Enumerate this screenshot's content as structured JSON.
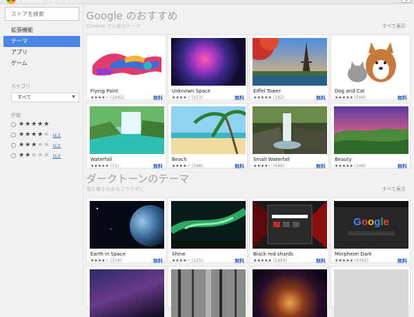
{
  "window": {
    "title": "Chrome ウェブストア",
    "corner_label": "×"
  },
  "search": {
    "placeholder": "ストアを検索"
  },
  "nav": [
    {
      "label": "拡張機能",
      "active": false
    },
    {
      "label": "テーマ",
      "active": true
    },
    {
      "label": "アプリ",
      "active": false
    },
    {
      "label": "ゲーム",
      "active": false
    }
  ],
  "filters": {
    "category_label": "カテゴリ",
    "category_value": "すべて",
    "rating_label": "評価",
    "rating_rows": [
      {
        "stars": 5,
        "suffix": ""
      },
      {
        "stars": 4,
        "suffix": "以上"
      },
      {
        "stars": 3,
        "suffix": "以上"
      },
      {
        "stars": 2,
        "suffix": "以上"
      }
    ]
  },
  "sections": [
    {
      "title": "Google のおすすめ",
      "subtitle": "Chrome で人気のテーマ",
      "view_all": "すべて表示"
    },
    {
      "title": "ダークトーンのテーマ",
      "subtitle": "落ち着きのあるブラウザに",
      "view_all": "すべて表示"
    }
  ],
  "cards": [
    {
      "name": "Flying Paint",
      "rating": 4,
      "count": "(1642)",
      "price": "無料",
      "thumb": "flying-paint"
    },
    {
      "name": "Unknown Space",
      "rating": 4,
      "count": "(523)",
      "price": "無料",
      "thumb": "unknown-space"
    },
    {
      "name": "Eiffel Tower",
      "rating": 4.5,
      "count": "(192)",
      "price": "無料",
      "thumb": "eiffel-tower"
    },
    {
      "name": "Dog and Cat",
      "rating": 4.5,
      "count": "(564)",
      "price": "無料",
      "thumb": "dog-and-cat"
    },
    {
      "name": "Waterfall",
      "rating": 4.5,
      "count": "(71)",
      "price": "無料",
      "thumb": "waterfall"
    },
    {
      "name": "Beach",
      "rating": 4,
      "count": "(598)",
      "price": "無料",
      "thumb": "beach"
    },
    {
      "name": "Small Waterfall",
      "rating": 4,
      "count": "(448)",
      "price": "無料",
      "thumb": "small-waterfall"
    },
    {
      "name": "Beauty",
      "rating": 4.5,
      "count": "(568)",
      "price": "無料",
      "thumb": "beauty"
    },
    {
      "name": "Earth in Space",
      "rating": 4,
      "count": "(374)",
      "price": "無料",
      "thumb": "earth-in-space"
    },
    {
      "name": "Shine",
      "rating": 4,
      "count": "(125)",
      "price": "無料",
      "thumb": "shine"
    },
    {
      "name": "Black red shards",
      "rating": 4.5,
      "count": "(2484)",
      "price": "無料",
      "thumb": "black-red-shards"
    },
    {
      "name": "Morpheon Dark",
      "rating": 4.5,
      "count": "(4392)",
      "price": "無料",
      "thumb": "morpheon-dark"
    },
    {
      "name": "",
      "rating": 0,
      "count": "",
      "price": "",
      "thumb": "starry-sky"
    },
    {
      "name": "",
      "rating": 0,
      "count": "",
      "price": "",
      "thumb": "dark-forest"
    },
    {
      "name": "",
      "rating": 0,
      "count": "",
      "price": "",
      "thumb": "planet-nebula"
    },
    {
      "name": "",
      "rating": 0,
      "count": "",
      "price": "",
      "thumb": "blank"
    }
  ],
  "morpheon_logo": "Google"
}
